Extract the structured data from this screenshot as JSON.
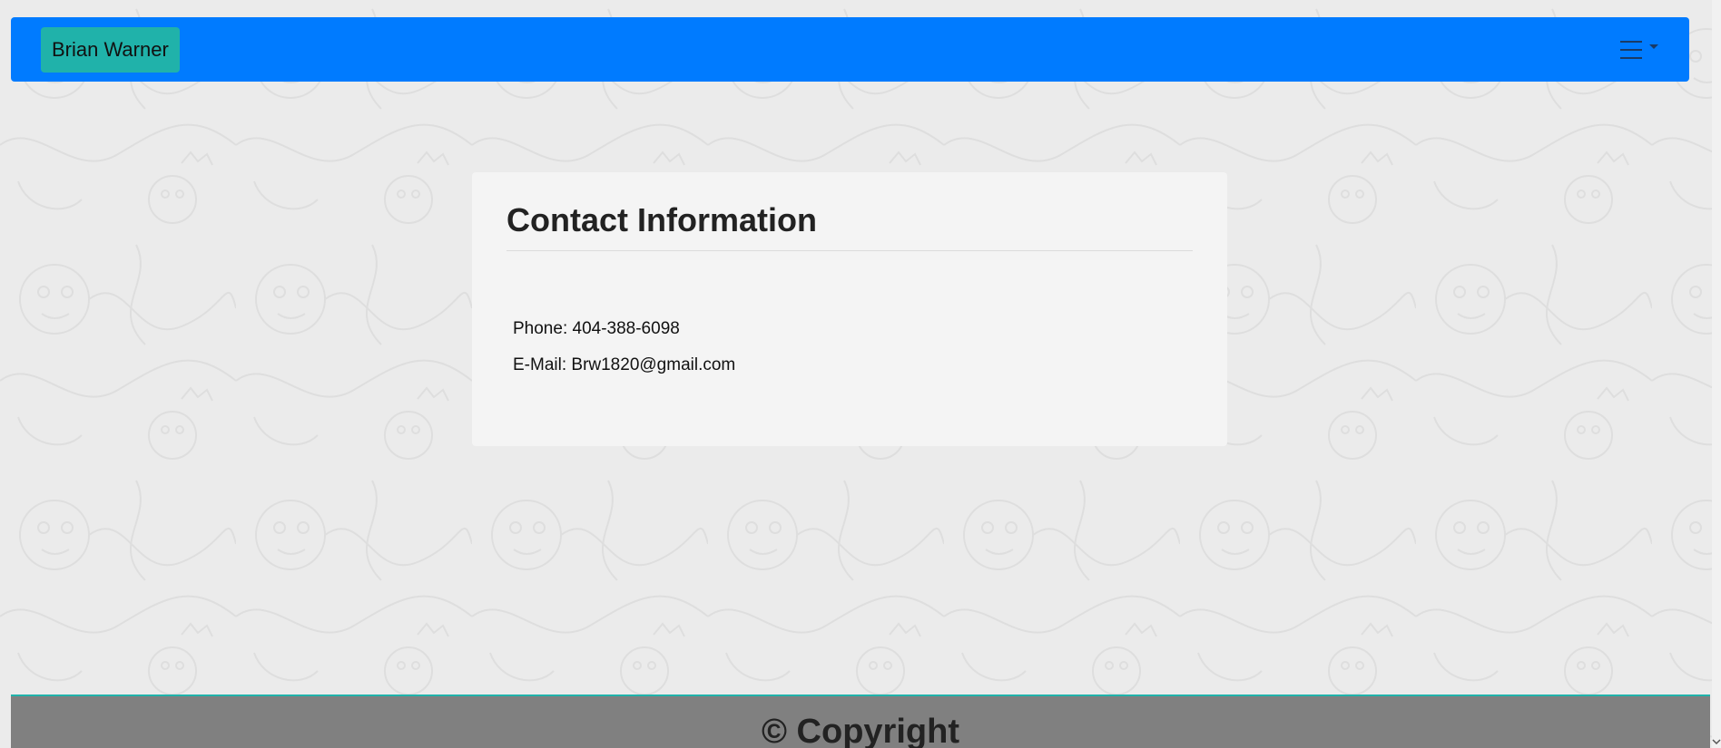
{
  "navbar": {
    "brand": "Brian Warner",
    "toggler_icon": "hamburger-menu-icon",
    "background": "#007bff",
    "brand_background": "#20b2aa"
  },
  "contact": {
    "title": "Contact Information",
    "phone": "Phone: 404-388-6098",
    "email": "E-Mail: Brw1820@gmail.com"
  },
  "footer": {
    "text": "© Copyright",
    "background": "#808080",
    "border_color": "#20b2aa"
  },
  "page": {
    "background": "#ebebeb"
  }
}
